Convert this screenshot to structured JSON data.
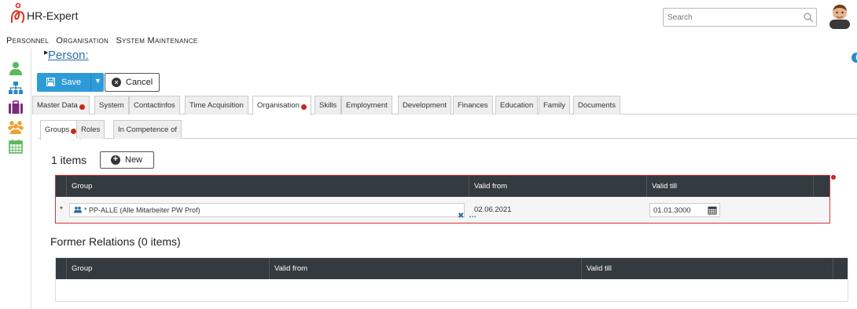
{
  "header": {
    "app_title": "HR-Expert",
    "search_placeholder": "Search"
  },
  "menu": [
    "Personnel",
    "Organisation",
    "System Maintenance"
  ],
  "page": {
    "title": "Person:"
  },
  "toolbar": {
    "save_label": "Save",
    "cancel_label": "Cancel"
  },
  "tabs": [
    {
      "label": "Master Data",
      "badge": true
    },
    {
      "label": "System",
      "badge": false
    },
    {
      "label": "Contactinfos",
      "badge": false
    },
    {
      "label": "Time Acquisition",
      "badge": false
    },
    {
      "label": "Organisation",
      "badge": true,
      "active": true
    },
    {
      "label": "Skills",
      "badge": false
    },
    {
      "label": "Employment",
      "badge": false
    },
    {
      "label": "Development",
      "badge": false
    },
    {
      "label": "Finances",
      "badge": false
    },
    {
      "label": "Education",
      "badge": false
    },
    {
      "label": "Family",
      "badge": false
    },
    {
      "label": "Documents",
      "badge": false
    }
  ],
  "subtabs": [
    {
      "label": "Groups",
      "badge": true,
      "active": true
    },
    {
      "label": "Roles",
      "badge": false
    },
    {
      "label": "In Competence of",
      "badge": false
    }
  ],
  "groups": {
    "count_label": "1 items",
    "new_label": "New",
    "columns": [
      "Group",
      "Valid from",
      "Valid till"
    ],
    "rows": [
      {
        "marker": "*",
        "group": "* PP-ALLE (Alle Mitarbeiter PW Prof)",
        "valid_from": "02.06.2021",
        "valid_till": "01.01.3000"
      }
    ]
  },
  "former": {
    "title": "Former Relations (0 items)",
    "columns": [
      "Group",
      "Valid from",
      "Valid till"
    ]
  },
  "colors": {
    "accent": "#2e9bd9",
    "grid_header": "#333a40",
    "error": "#c52a1a"
  },
  "icons": [
    "person-icon",
    "org-chart-icon",
    "briefcase-icon",
    "group-icon",
    "calendar-icon"
  ]
}
